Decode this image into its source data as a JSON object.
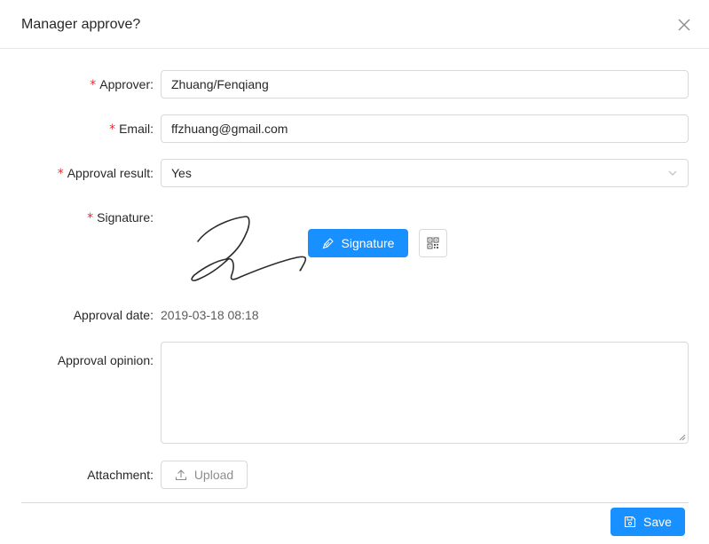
{
  "modal": {
    "title": "Manager approve?"
  },
  "form": {
    "required_mark": "*",
    "approver": {
      "label": "Approver:",
      "value": "Zhuang/Fenqiang"
    },
    "email": {
      "label": "Email:",
      "value": "ffzhuang@gmail.com"
    },
    "approval_result": {
      "label": "Approval result:",
      "value": "Yes"
    },
    "signature": {
      "label": "Signature:",
      "button_label": "Signature"
    },
    "approval_date": {
      "label": "Approval date:",
      "value": "2019-03-18 08:18"
    },
    "approval_opinion": {
      "label": "Approval opinion:",
      "value": ""
    },
    "attachment": {
      "label": "Attachment:",
      "button_label": "Upload"
    }
  },
  "footer": {
    "save_label": "Save"
  },
  "colors": {
    "primary": "#1890ff",
    "required": "#f5222d",
    "border": "#d9d9d9"
  }
}
